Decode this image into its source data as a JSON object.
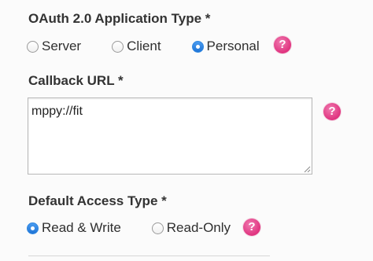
{
  "oauth_type": {
    "label": "OAuth 2.0 Application Type *",
    "options": [
      {
        "label": "Server",
        "checked": false
      },
      {
        "label": "Client",
        "checked": false
      },
      {
        "label": "Personal",
        "checked": true
      }
    ],
    "help_glyph": "?"
  },
  "callback": {
    "label": "Callback URL *",
    "value": "mppy://fit",
    "help_glyph": "?"
  },
  "access_type": {
    "label": "Default Access Type *",
    "options": [
      {
        "label": "Read & Write",
        "checked": true
      },
      {
        "label": "Read-Only",
        "checked": false
      }
    ],
    "help_glyph": "?"
  },
  "colors": {
    "radio_checked": "#2f86e0",
    "help_icon": "#e0337f",
    "label_text": "#333333"
  },
  "icons": {
    "help": "question-mark-circle-icon",
    "resize": "resize-grip-icon"
  }
}
